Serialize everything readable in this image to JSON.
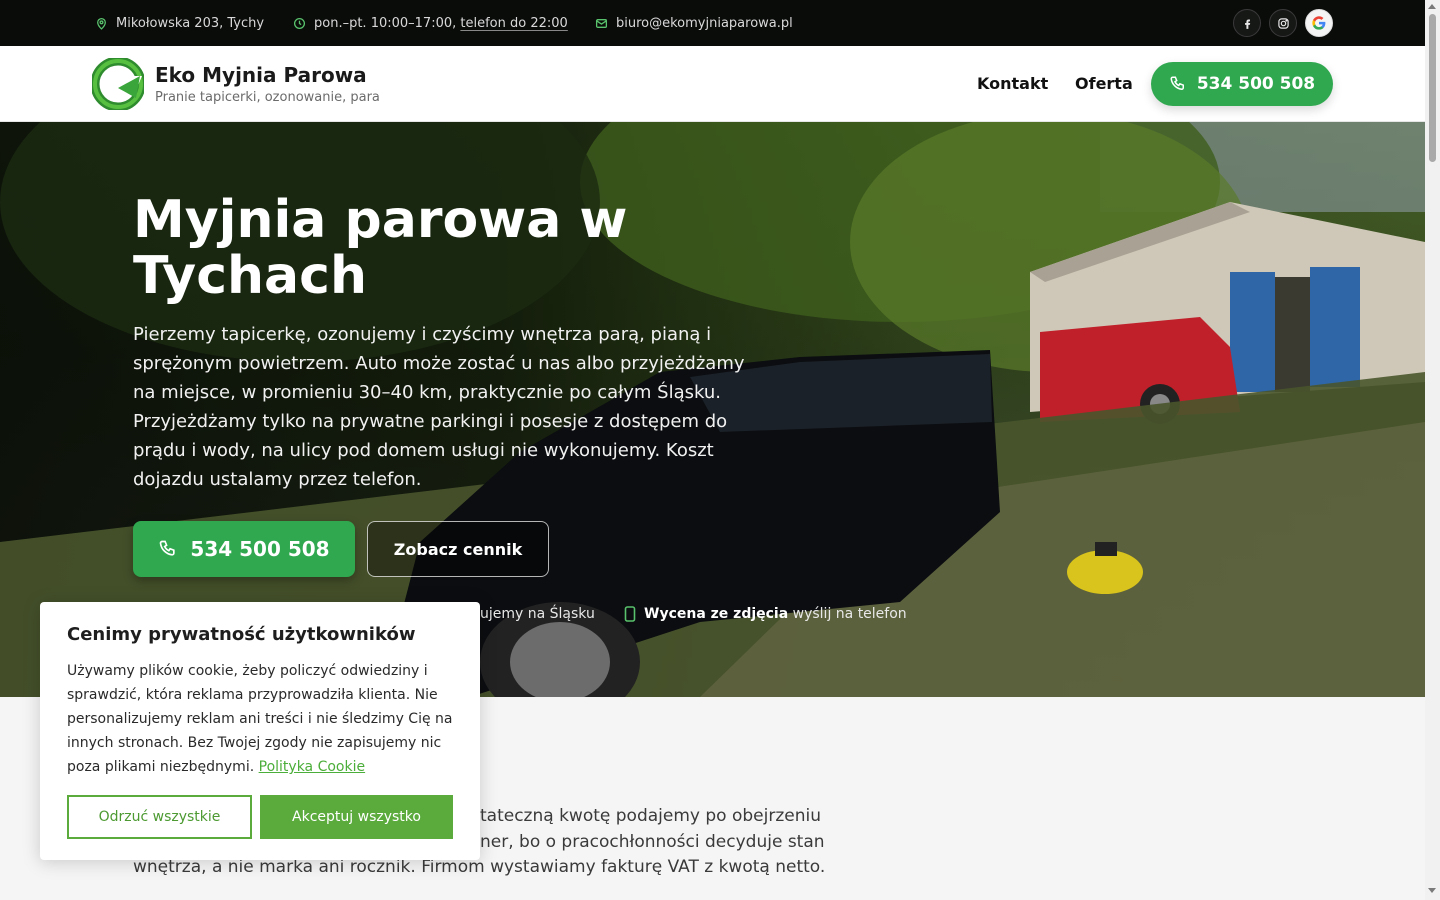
{
  "topbar": {
    "address": "Mikołowska 203, Tychy",
    "hours_prefix": "pon.–pt. 10:00–17:00, ",
    "hours_link": "telefon do 22:00",
    "email": "biuro@ekomyjniaparowa.pl",
    "icons": [
      "map-pin-icon",
      "clock-icon",
      "mail-icon",
      "facebook-icon",
      "instagram-icon",
      "google-icon"
    ]
  },
  "header": {
    "brand_name": "Eko Myjnia Parowa",
    "tagline": "Pranie tapicerki, ozonowanie, para",
    "nav": [
      "Kontakt",
      "Oferta"
    ],
    "phone": "534 500 508"
  },
  "hero": {
    "title": "Myjnia parowa w Tychach",
    "text": "Pierzemy tapicerkę, ozonujemy i czyścimy wnętrza parą, pianą i sprężonym powietrzem. Auto może zostać u nas albo przyjeżdżamy na miejsce, w promieniu 30–40 km, praktycznie po całym Śląsku. Przyjeżdżamy tylko na prywatne parkingi i posesje z dostępem do prądu i wody, na ulicy pod domem usługi nie wykonujemy. Koszt dojazdu ustalamy przez telefon.",
    "phone_button": "534 500 508",
    "price_button": "Zobacz cennik",
    "feature_partial": "ujemy na Śląsku",
    "feature2_bold": "Wycena ze zdjęcia",
    "feature2_rest": "wyślij na telefon"
  },
  "below": {
    "text_line1": "tateczną kwotę podajemy po obejrzeniu",
    "text_line2": "ner, bo o pracochłonności decyduje stan",
    "text_line3": "wnętrza, a nie marka ani rocznik. Firmom wystawiamy fakturę VAT z kwotą netto."
  },
  "cookie": {
    "title": "Cenimy prywatność użytkowników",
    "text": "Używamy plików cookie, żeby policzyć odwiedziny i sprawdzić, która reklama przyprowadziła klienta. Nie personalizujemy reklam ani treści i nie śledzimy Cię na innych stronach. Bez Twojej zgody nie zapisujemy nic poza plikami niezbędnymi. ",
    "link": "Polityka Cookie",
    "reject": "Odrzuć wszystkie",
    "accept": "Akceptuj wszystko"
  },
  "colors": {
    "accent_green": "#2fa84f",
    "cookie_green": "#5aaa3c",
    "topbar_bg": "#0a0c0a"
  }
}
